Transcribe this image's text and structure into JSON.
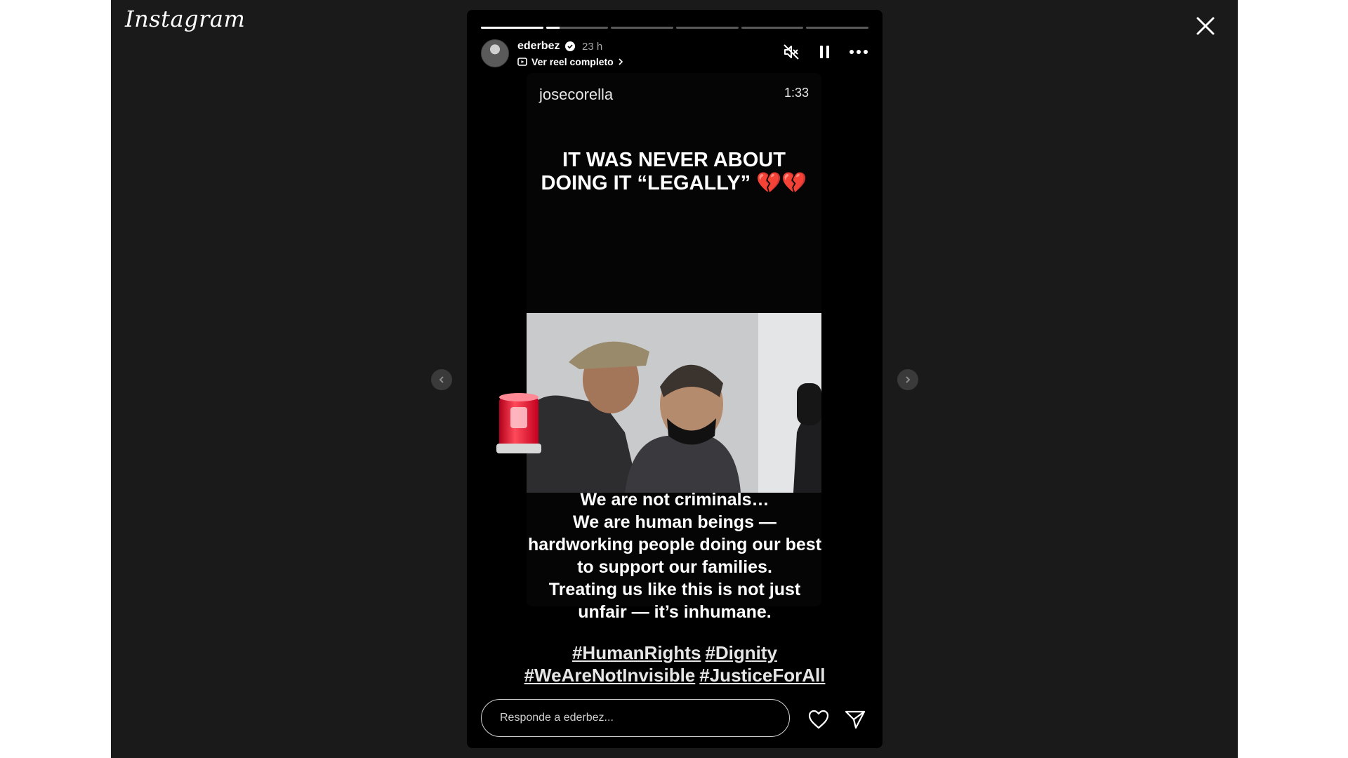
{
  "app": {
    "logo_text": "Instagram"
  },
  "story": {
    "username": "ederbez",
    "time": "23 h",
    "reel_link": "Ver reel completo",
    "progress": {
      "segments": 6,
      "current": 1,
      "current_fraction": 0.22
    }
  },
  "video": {
    "username": "josecorella",
    "duration": "1:33",
    "headline": "IT WAS NEVER ABOUT DOING IT “LEGALLY” 💔💔",
    "caption_lines": [
      "We are not criminals…",
      "We are human beings —",
      "hardworking people doing our best",
      "to support our families.",
      "Treating us like this is not just",
      "unfair — it’s inhumane."
    ],
    "hashtags": [
      "#HumanRights",
      "#Dignity",
      "#WeAreNotInvisible",
      "#JusticeForAll"
    ]
  },
  "reply": {
    "placeholder": "Responde a ederbez..."
  },
  "icons": {
    "close": "close-icon",
    "mute": "speaker-muted-icon",
    "pause": "pause-icon",
    "more": "more-options-icon",
    "like": "heart-icon",
    "share": "send-icon",
    "verified": "verified-badge-icon",
    "reel": "reel-icon",
    "siren": "siren-sticker"
  },
  "colors": {
    "backdrop": "#1a1a1a",
    "story_bg": "#000000",
    "text": "#ffffff",
    "muted_text": "#a8a8a8"
  }
}
